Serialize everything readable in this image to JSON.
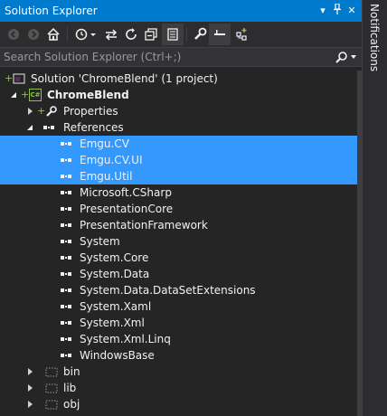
{
  "window": {
    "title": "Solution Explorer",
    "buttons": {
      "dropdown": "▾",
      "pin": "ᅳ",
      "close": "✕"
    }
  },
  "toolbar": {
    "icons": [
      "back-icon",
      "forward-icon",
      "home-icon",
      "history-icon",
      "sync-icon",
      "refresh-icon",
      "collapse-all-icon",
      "show-all-files-icon",
      "properties-icon",
      "preview-icon",
      "new-view-icon"
    ]
  },
  "search": {
    "placeholder": "Search Solution Explorer (Ctrl+;)"
  },
  "tree": {
    "solution": "Solution 'ChromeBlend' (1 project)",
    "project": "ChromeBlend",
    "project_badge": "C#",
    "properties": "Properties",
    "references": "References",
    "refs": [
      {
        "label": "Emgu.CV",
        "selected": true
      },
      {
        "label": "Emgu.CV.UI",
        "selected": true
      },
      {
        "label": "Emgu.Util",
        "selected": true
      },
      {
        "label": "Microsoft.CSharp",
        "selected": false
      },
      {
        "label": "PresentationCore",
        "selected": false
      },
      {
        "label": "PresentationFramework",
        "selected": false
      },
      {
        "label": "System",
        "selected": false
      },
      {
        "label": "System.Core",
        "selected": false
      },
      {
        "label": "System.Data",
        "selected": false
      },
      {
        "label": "System.Data.DataSetExtensions",
        "selected": false
      },
      {
        "label": "System.Xaml",
        "selected": false
      },
      {
        "label": "System.Xml",
        "selected": false
      },
      {
        "label": "System.Xml.Linq",
        "selected": false
      },
      {
        "label": "WindowsBase",
        "selected": false
      }
    ],
    "folders": [
      "bin",
      "lib",
      "obj"
    ]
  },
  "side_tab": {
    "label": "Notifications"
  },
  "colors": {
    "accent": "#007acc",
    "selection": "#3399ff",
    "background": "#252526"
  }
}
